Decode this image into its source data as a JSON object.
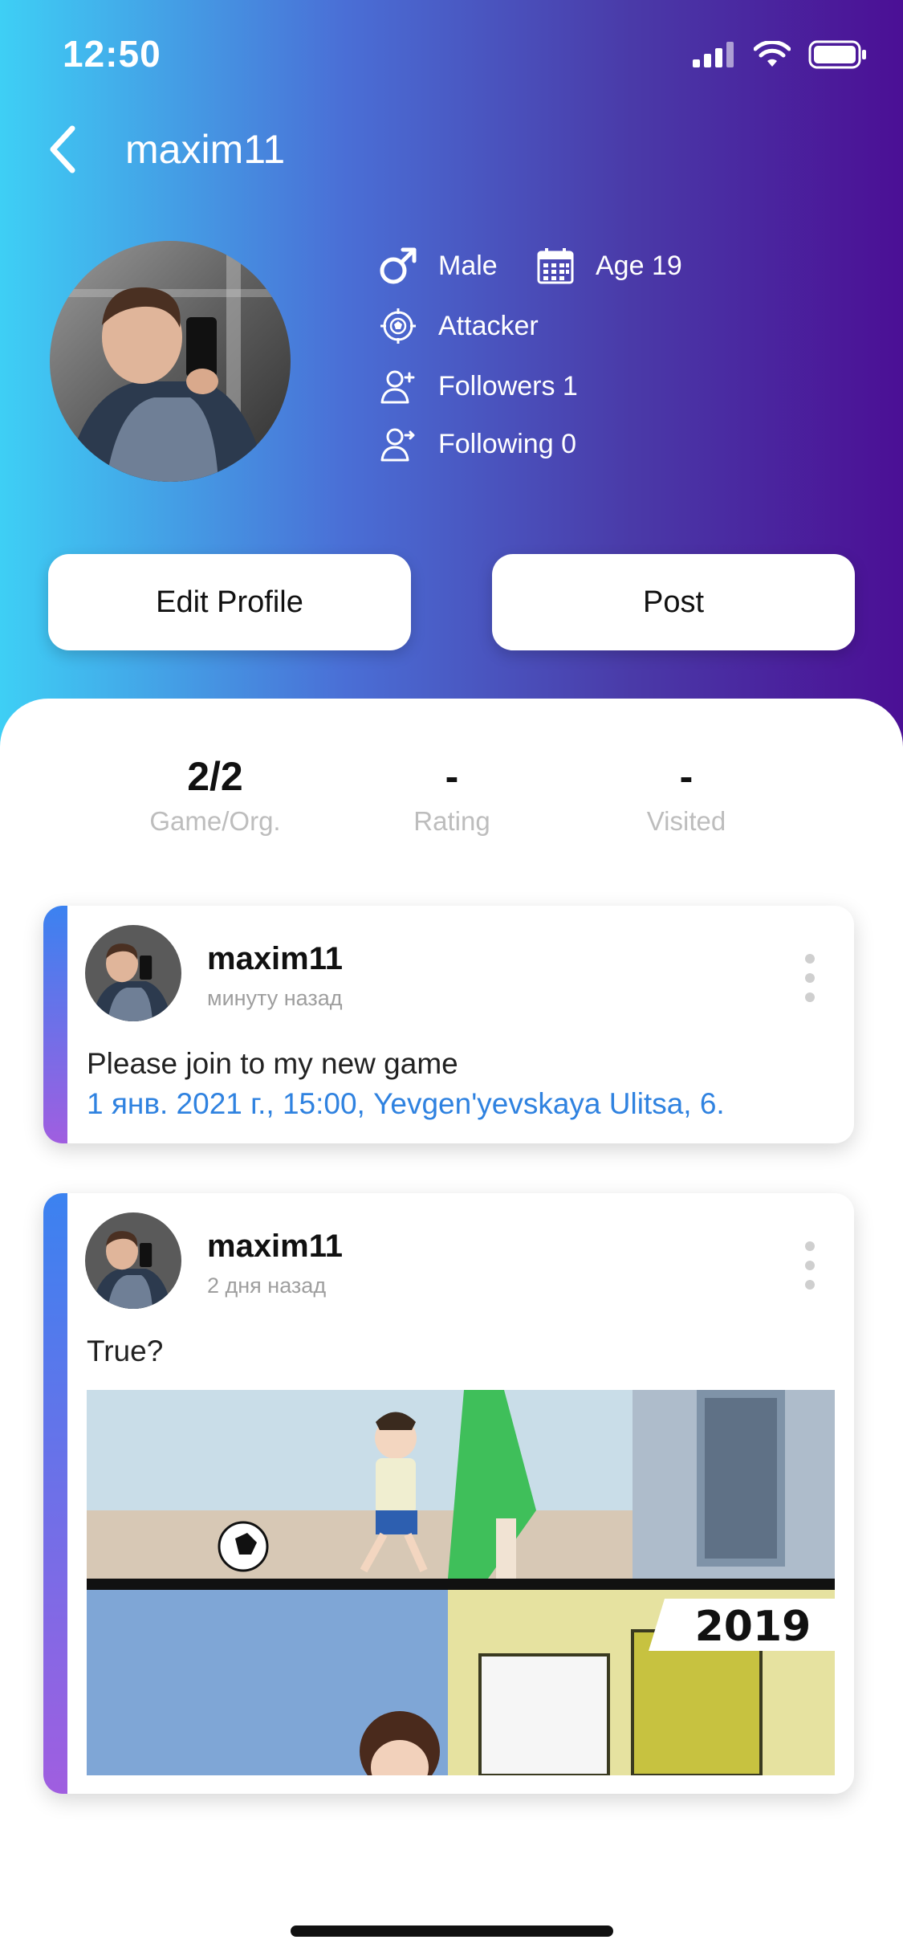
{
  "status_bar": {
    "time": "12:50"
  },
  "nav": {
    "title": "maxim11"
  },
  "profile": {
    "gender": "Male",
    "age": "Age 19",
    "position": "Attacker",
    "followers": "Followers 1",
    "following": "Following 0"
  },
  "actions": {
    "edit_profile": "Edit Profile",
    "post": "Post"
  },
  "stats": [
    {
      "value": "2/2",
      "label": "Game/Org."
    },
    {
      "value": "-",
      "label": "Rating"
    },
    {
      "value": "-",
      "label": "Visited"
    }
  ],
  "posts": [
    {
      "author": "maxim11",
      "time": "минуту назад",
      "text": "Please join to my new game",
      "link": "1 янв. 2021 г., 15:00, Yevgen'yevskaya Ulitsa, 6."
    },
    {
      "author": "maxim11",
      "time": "2 дня назад",
      "text": "True?",
      "image_caption": "2019"
    }
  ],
  "colors": {
    "gradient_start": "#3ecff5",
    "gradient_end": "#4b0f95",
    "link": "#2f82e0",
    "accent_top": "#3b82f0",
    "accent_bottom": "#a05ee0"
  },
  "icons": {
    "back": "chevron-left-icon",
    "gender": "male-icon",
    "age": "calendar-icon",
    "position": "soccer-target-icon",
    "followers": "user-add-icon",
    "following": "user-forward-icon",
    "more": "more-vertical-icon"
  }
}
